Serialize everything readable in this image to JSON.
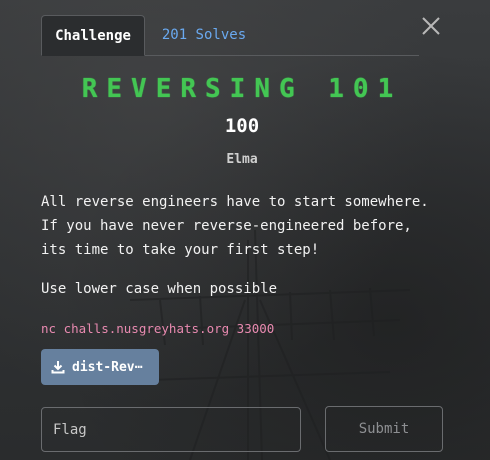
{
  "tabs": [
    {
      "label": "Challenge",
      "active": true
    },
    {
      "label": "201 Solves",
      "active": false
    }
  ],
  "challenge": {
    "name": "REVERSING 101",
    "points": "100",
    "author": "Elma",
    "description": [
      "All reverse engineers have to start somewhere. If you have never reverse-engineered before, its time to take your first step!",
      "Use lower case when possible"
    ],
    "connection": "nc challs.nusgreyhats.org 33000",
    "file_button_label": "dist-Rev⋯"
  },
  "flag_input": {
    "value": "",
    "placeholder": "Flag"
  },
  "submit_label": "Submit",
  "icons": {
    "close": "close-icon",
    "download": "download-icon"
  },
  "colors": {
    "title": "#43c653",
    "inactive_tab": "#6aa9f0",
    "connection_text": "#e88ab0",
    "file_button": "#66809e"
  }
}
